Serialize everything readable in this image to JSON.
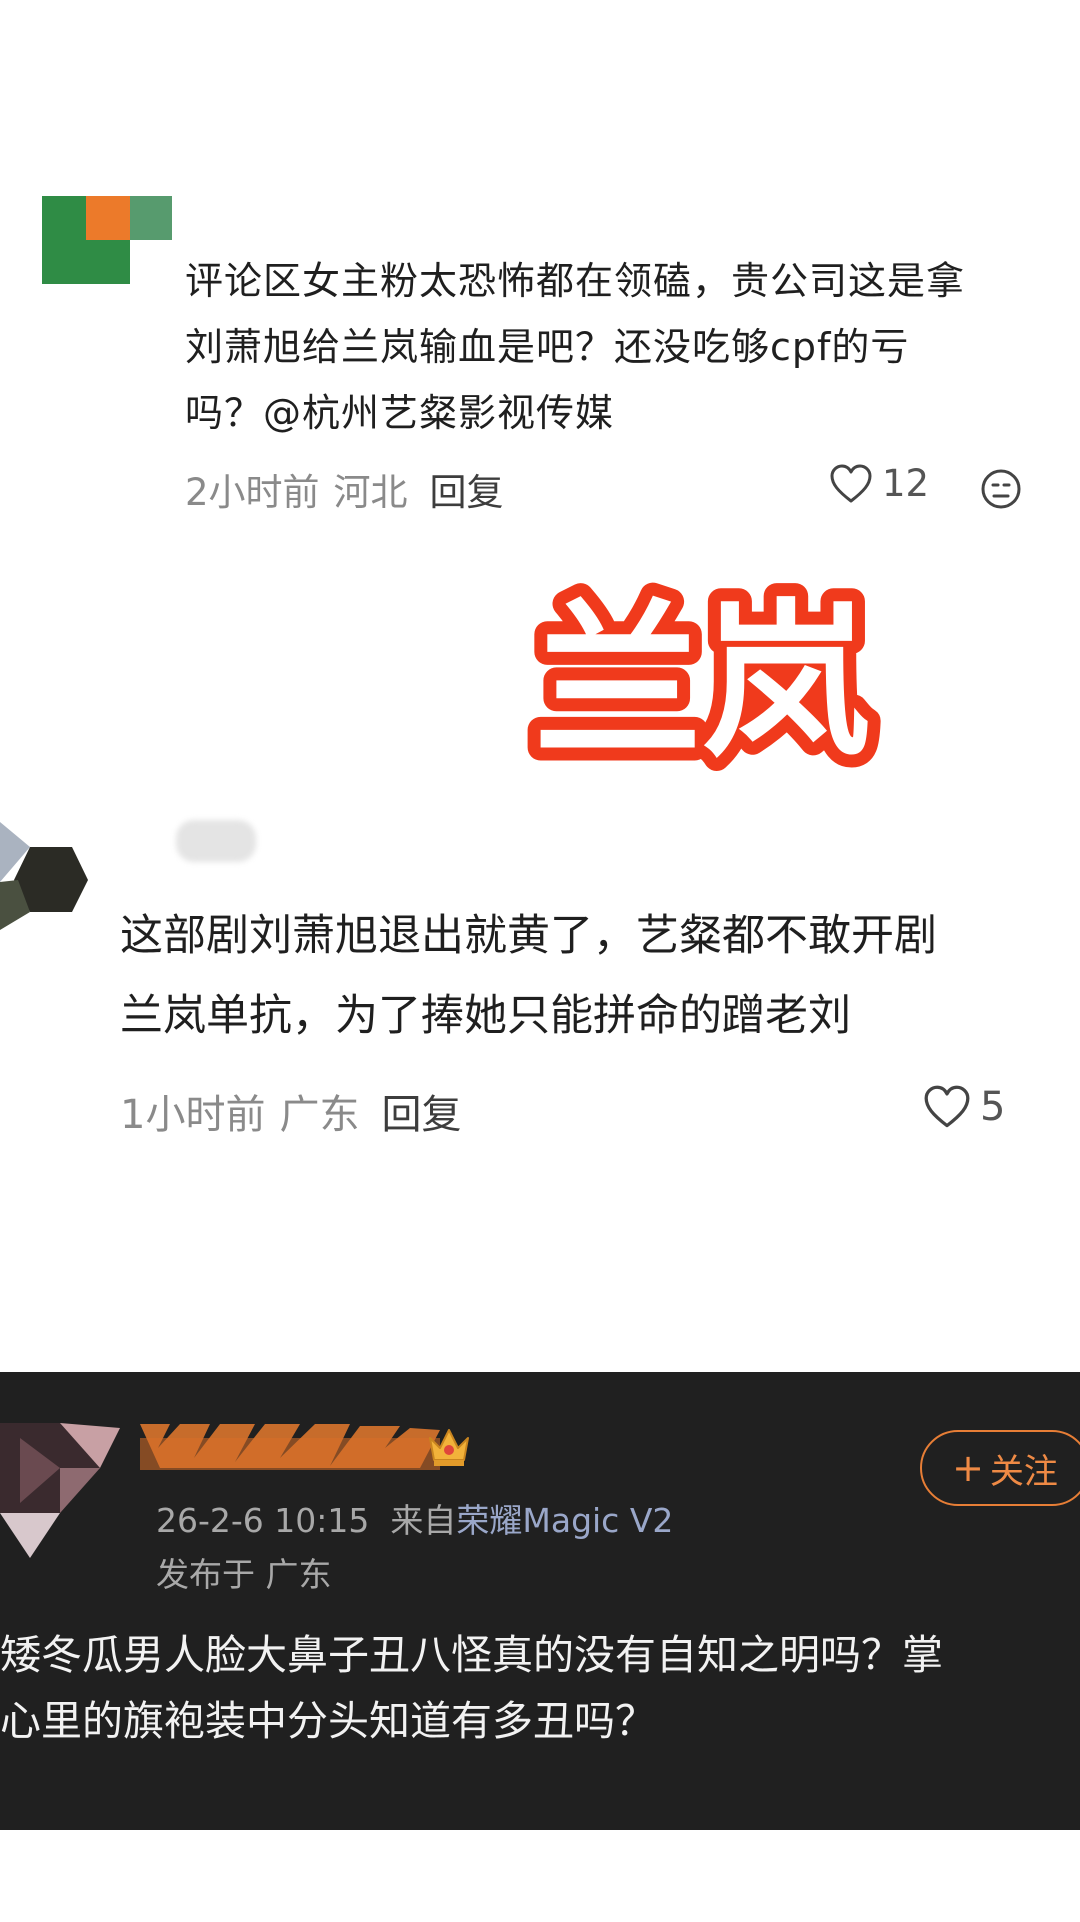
{
  "comments": [
    {
      "text_lines": [
        "评论区女主粉太恐怖都在领磕，贵公司这是拿",
        "刘萧旭给兰岚输血是吧？还没吃够cpf的亏",
        "吗？@杭州艺粲影视传媒"
      ],
      "time": "2小时前",
      "region": "河北",
      "reply_label": "回复",
      "likes": "12"
    },
    {
      "text_lines": [
        "这部剧刘萧旭退出就黄了，艺粲都不敢开剧",
        "兰岚单抗，为了捧她只能拼命的蹭老刘"
      ],
      "time": "1小时前",
      "region": "广东",
      "reply_label": "回复",
      "likes": "5"
    }
  ],
  "sticker": {
    "text": "兰岚",
    "fill_color": "#ffffff",
    "outline_color": "#f03a1c"
  },
  "post": {
    "time": "26-2-6 10:15",
    "source_prefix": "来自",
    "device": "荣耀Magic V2",
    "published_prefix": "发布于",
    "region": "广东",
    "follow_label": "关注",
    "body_lines": [
      "矮冬瓜男人脸大鼻子丑八怪真的没有自知之明吗？掌",
      "心里的旗袍装中分头知道有多丑吗？"
    ],
    "accent_color": "#e77e36",
    "background_color": "#202020"
  }
}
